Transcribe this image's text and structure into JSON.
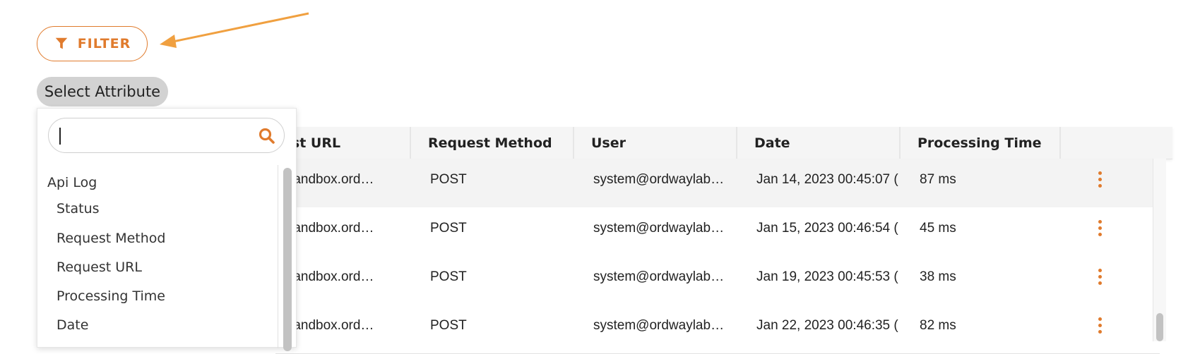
{
  "filter_button": {
    "label": "FILTER",
    "icon": "funnel-icon"
  },
  "attribute_selector": {
    "label": "Select Attribute"
  },
  "attribute_dropdown": {
    "search": {
      "value": "",
      "placeholder": "",
      "icon": "search-icon"
    },
    "group": "Api Log",
    "items": [
      "Status",
      "Request Method",
      "Request URL",
      "Processing Time",
      "Date"
    ]
  },
  "table": {
    "columns": [
      "est URL",
      "Request Method",
      "User",
      "Date",
      "Processing Time"
    ],
    "rows": [
      {
        "url": "://sandbox.ord…",
        "method": "POST",
        "user": "system@ordwaylab…",
        "date": "Jan 14, 2023 00:45:07 (",
        "time": "87 ms"
      },
      {
        "url": "://sandbox.ord…",
        "method": "POST",
        "user": "system@ordwaylab…",
        "date": "Jan 15, 2023 00:46:54 (",
        "time": "45 ms"
      },
      {
        "url": "://sandbox.ord…",
        "method": "POST",
        "user": "system@ordwaylab…",
        "date": "Jan 19, 2023 00:45:53 (",
        "time": "38 ms"
      },
      {
        "url": "://sandbox.ord…",
        "method": "POST",
        "user": "system@ordwaylab…",
        "date": "Jan 22, 2023 00:46:35 (",
        "time": "82 ms"
      }
    ],
    "row_action_icon": "kebab-menu-icon"
  },
  "colors": {
    "accent": "#e07b2d",
    "pill_bg": "#d2d2d2",
    "header_bg": "#f5f5f5"
  }
}
